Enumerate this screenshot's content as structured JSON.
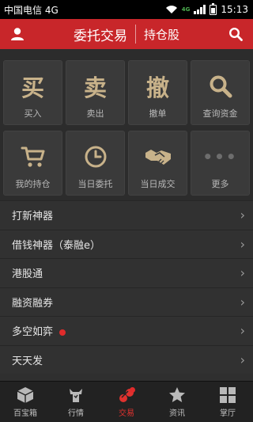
{
  "status": {
    "carrier": "中国电信 4G",
    "time": "15:13",
    "net": "4G"
  },
  "appbar": {
    "title": "委托交易",
    "subtitle": "持仓股"
  },
  "grid": [
    {
      "label": "买入",
      "glyph": "买"
    },
    {
      "label": "卖出",
      "glyph": "卖"
    },
    {
      "label": "撤单",
      "glyph": "撤"
    },
    {
      "label": "查询资金",
      "glyph": ""
    },
    {
      "label": "我的持仓",
      "glyph": ""
    },
    {
      "label": "当日委托",
      "glyph": ""
    },
    {
      "label": "当日成交",
      "glyph": ""
    },
    {
      "label": "更多",
      "glyph": "•••"
    }
  ],
  "list": [
    {
      "label": "打新神器"
    },
    {
      "label": "借钱神器（泰融e）"
    },
    {
      "label": "港股通"
    },
    {
      "label": "融资融券"
    },
    {
      "label": "多空如弈"
    },
    {
      "label": "天天发"
    }
  ],
  "tabs": [
    {
      "label": "百宝箱"
    },
    {
      "label": "行情"
    },
    {
      "label": "交易"
    },
    {
      "label": "资讯"
    },
    {
      "label": "掌厅"
    }
  ],
  "colors": {
    "brand": "#c8262a",
    "accent_glyph": "#c8b28a",
    "active_tab": "#e0322f"
  }
}
